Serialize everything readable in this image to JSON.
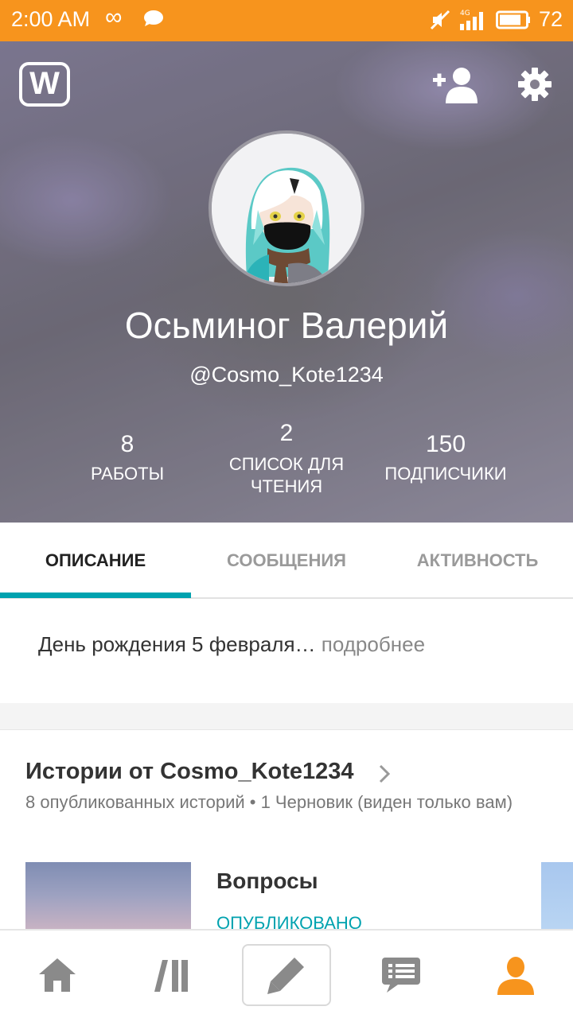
{
  "status_bar": {
    "time": "2:00 AM",
    "network": "4G",
    "battery": "72",
    "color": "#f7941d"
  },
  "profile": {
    "display_name": "Осьминог Валерий",
    "username": "@Cosmo_Kote1234",
    "stats": {
      "works": {
        "value": "8",
        "label": "РАБОТЫ"
      },
      "reading_lists": {
        "value": "2",
        "label_line1": "СПИСОК ДЛЯ",
        "label_line2": "ЧТЕНИЯ"
      },
      "followers": {
        "value": "150",
        "label": "ПОДПИСЧИКИ"
      }
    }
  },
  "tabs": [
    {
      "label": "ОПИСАНИЕ",
      "active": true
    },
    {
      "label": "СООБЩЕНИЯ",
      "active": false
    },
    {
      "label": "АКТИВНОСТЬ",
      "active": false
    }
  ],
  "description": {
    "text": "День рождения 5 февраля…",
    "more": "подробнее"
  },
  "stories": {
    "title": "Истории от Cosmo_Kote1234",
    "subtitle": "8 опубликованных историй • 1 Черновик (виден только вам)",
    "items": [
      {
        "title": "Вопросы",
        "status": "ОПУБЛИКОВАНО"
      }
    ]
  },
  "bottom_nav": {
    "items": [
      "home-icon",
      "library-icon",
      "write-icon",
      "messages-icon",
      "profile-icon"
    ],
    "active": "profile-icon",
    "accent": "#f7941d",
    "tab_accent": "#00a2af"
  }
}
